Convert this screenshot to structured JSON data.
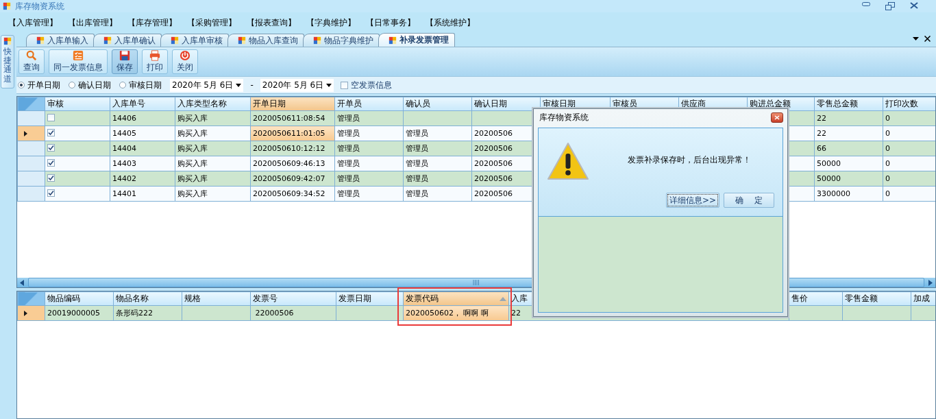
{
  "window": {
    "title": "库存物资系统"
  },
  "menu": [
    "【入库管理】",
    "【出库管理】",
    "【库存管理】",
    "【采购管理】",
    "【报表查询】",
    "【字典维护】",
    "【日常事务】",
    "【系统维护】"
  ],
  "sidebar": {
    "label": "快捷通道"
  },
  "tabs": [
    {
      "label": "入库单输入",
      "selected": false
    },
    {
      "label": "入库单确认",
      "selected": false
    },
    {
      "label": "入库单审核",
      "selected": false
    },
    {
      "label": "物品入库查询",
      "selected": false
    },
    {
      "label": "物品字典维护",
      "selected": false
    },
    {
      "label": "补录发票管理",
      "selected": true
    }
  ],
  "toolbar": [
    {
      "label": "查询",
      "kind": "search",
      "pressed": false
    },
    {
      "label": "同一发票信息",
      "kind": "list",
      "pressed": false
    },
    {
      "label": "保存",
      "kind": "save",
      "pressed": true
    },
    {
      "label": "打印",
      "kind": "print",
      "pressed": false
    },
    {
      "label": "关闭",
      "kind": "power",
      "pressed": false
    }
  ],
  "filter": {
    "date_options": [
      {
        "label": "开单日期",
        "selected": true
      },
      {
        "label": "确认日期",
        "selected": false
      },
      {
        "label": "审核日期",
        "selected": false
      }
    ],
    "date_from": "2020年 5月 6日",
    "separator": "-",
    "date_to": "2020年 5月 6日",
    "empty_invoice": {
      "label": "空发票信息",
      "checked": false
    }
  },
  "orders_grid": {
    "check_column": {
      "label": "审核"
    },
    "columns": [
      {
        "label": "入库单号",
        "selected": false
      },
      {
        "label": "入库类型名称",
        "selected": false
      },
      {
        "label": "开单日期",
        "selected": true
      },
      {
        "label": "开单员",
        "selected": false
      },
      {
        "label": "确认员",
        "selected": false
      },
      {
        "label": "确认日期",
        "selected": false
      },
      {
        "label": "审核日期",
        "selected": false
      },
      {
        "label": "审核员",
        "selected": false
      },
      {
        "label": "供应商",
        "selected": false
      },
      {
        "label": "购进总金额",
        "selected": false
      },
      {
        "label": "零售总金额",
        "selected": false
      },
      {
        "label": "打印次数",
        "selected": false
      }
    ],
    "rows": [
      {
        "selected": false,
        "checked": false,
        "cells": [
          "14406",
          "购买入库",
          "2020050611:08:54",
          "管理员",
          null,
          null,
          null,
          null,
          null,
          null,
          "22",
          "0"
        ]
      },
      {
        "selected": true,
        "checked": true,
        "cells": [
          "14405",
          "购买入库",
          "2020050611:01:05",
          "管理员",
          "管理员",
          "20200506",
          null,
          null,
          null,
          null,
          "22",
          "0"
        ]
      },
      {
        "selected": false,
        "checked": true,
        "cells": [
          "14404",
          "购买入库",
          "2020050610:12:12",
          "管理员",
          "管理员",
          "20200506",
          null,
          null,
          null,
          null,
          "66",
          "0"
        ]
      },
      {
        "selected": false,
        "checked": true,
        "cells": [
          "14403",
          "购买入库",
          "2020050609:46:13",
          "管理员",
          "管理员",
          "20200506",
          null,
          null,
          null,
          null,
          "50000",
          "0"
        ]
      },
      {
        "selected": false,
        "checked": true,
        "cells": [
          "14402",
          "购买入库",
          "2020050609:42:07",
          "管理员",
          "管理员",
          "20200506",
          null,
          null,
          null,
          null,
          "50000",
          "0"
        ]
      },
      {
        "selected": false,
        "checked": true,
        "cells": [
          "14401",
          "购买入库",
          "2020050609:34:52",
          "管理员",
          "管理员",
          "20200506",
          null,
          null,
          null,
          null,
          "3300000",
          "0"
        ]
      }
    ]
  },
  "items_grid": {
    "columns": [
      {
        "label": "物品编码",
        "selected": false
      },
      {
        "label": "物品名称",
        "selected": false
      },
      {
        "label": "规格",
        "selected": false
      },
      {
        "label": "发票号",
        "selected": false
      },
      {
        "label": "发票日期",
        "selected": false
      },
      {
        "label": "发票代码",
        "selected": true
      },
      {
        "label": "入库",
        "selected": false
      },
      {
        "label": "售价",
        "selected": false
      },
      {
        "label": "零售金额",
        "selected": false
      },
      {
        "label": "加成",
        "selected": false
      }
    ],
    "rows": [
      {
        "selected": true,
        "cells": [
          "20019000005",
          "条形码222",
          null,
          " 22000506",
          null,
          "2020050602， 啊啊 啊",
          "22",
          null,
          null,
          null
        ]
      }
    ]
  },
  "dialog": {
    "title": "库存物资系统",
    "message": "发票补录保存时，后台出现异常！",
    "buttons": [
      "详细信息>>",
      "确    定"
    ]
  }
}
